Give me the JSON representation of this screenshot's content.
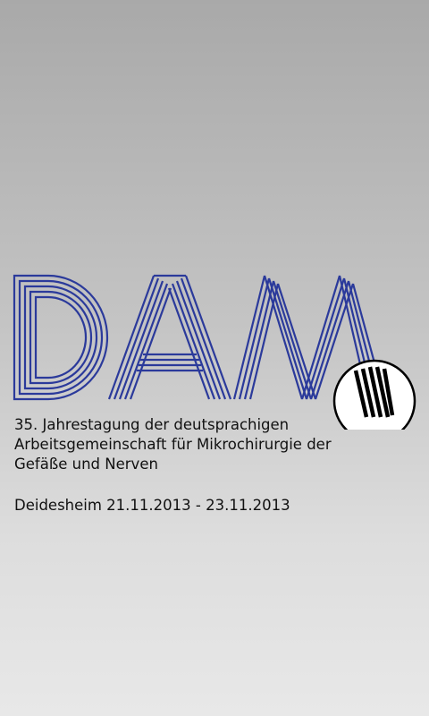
{
  "splash": {
    "logo_text": "DAM",
    "description": "35. Jahrestagung der deutsprachigen\nArbeitsgemeinschaft für Mikrochirurgie der\nGefäße und Nerven",
    "location_dates": "Deidesheim 21.11.2013 - 23.11.2013"
  },
  "colors": {
    "logo_stroke": "#2b3a9b",
    "background_top": "#a9a9a9",
    "background_bottom": "#e8e8e8"
  }
}
